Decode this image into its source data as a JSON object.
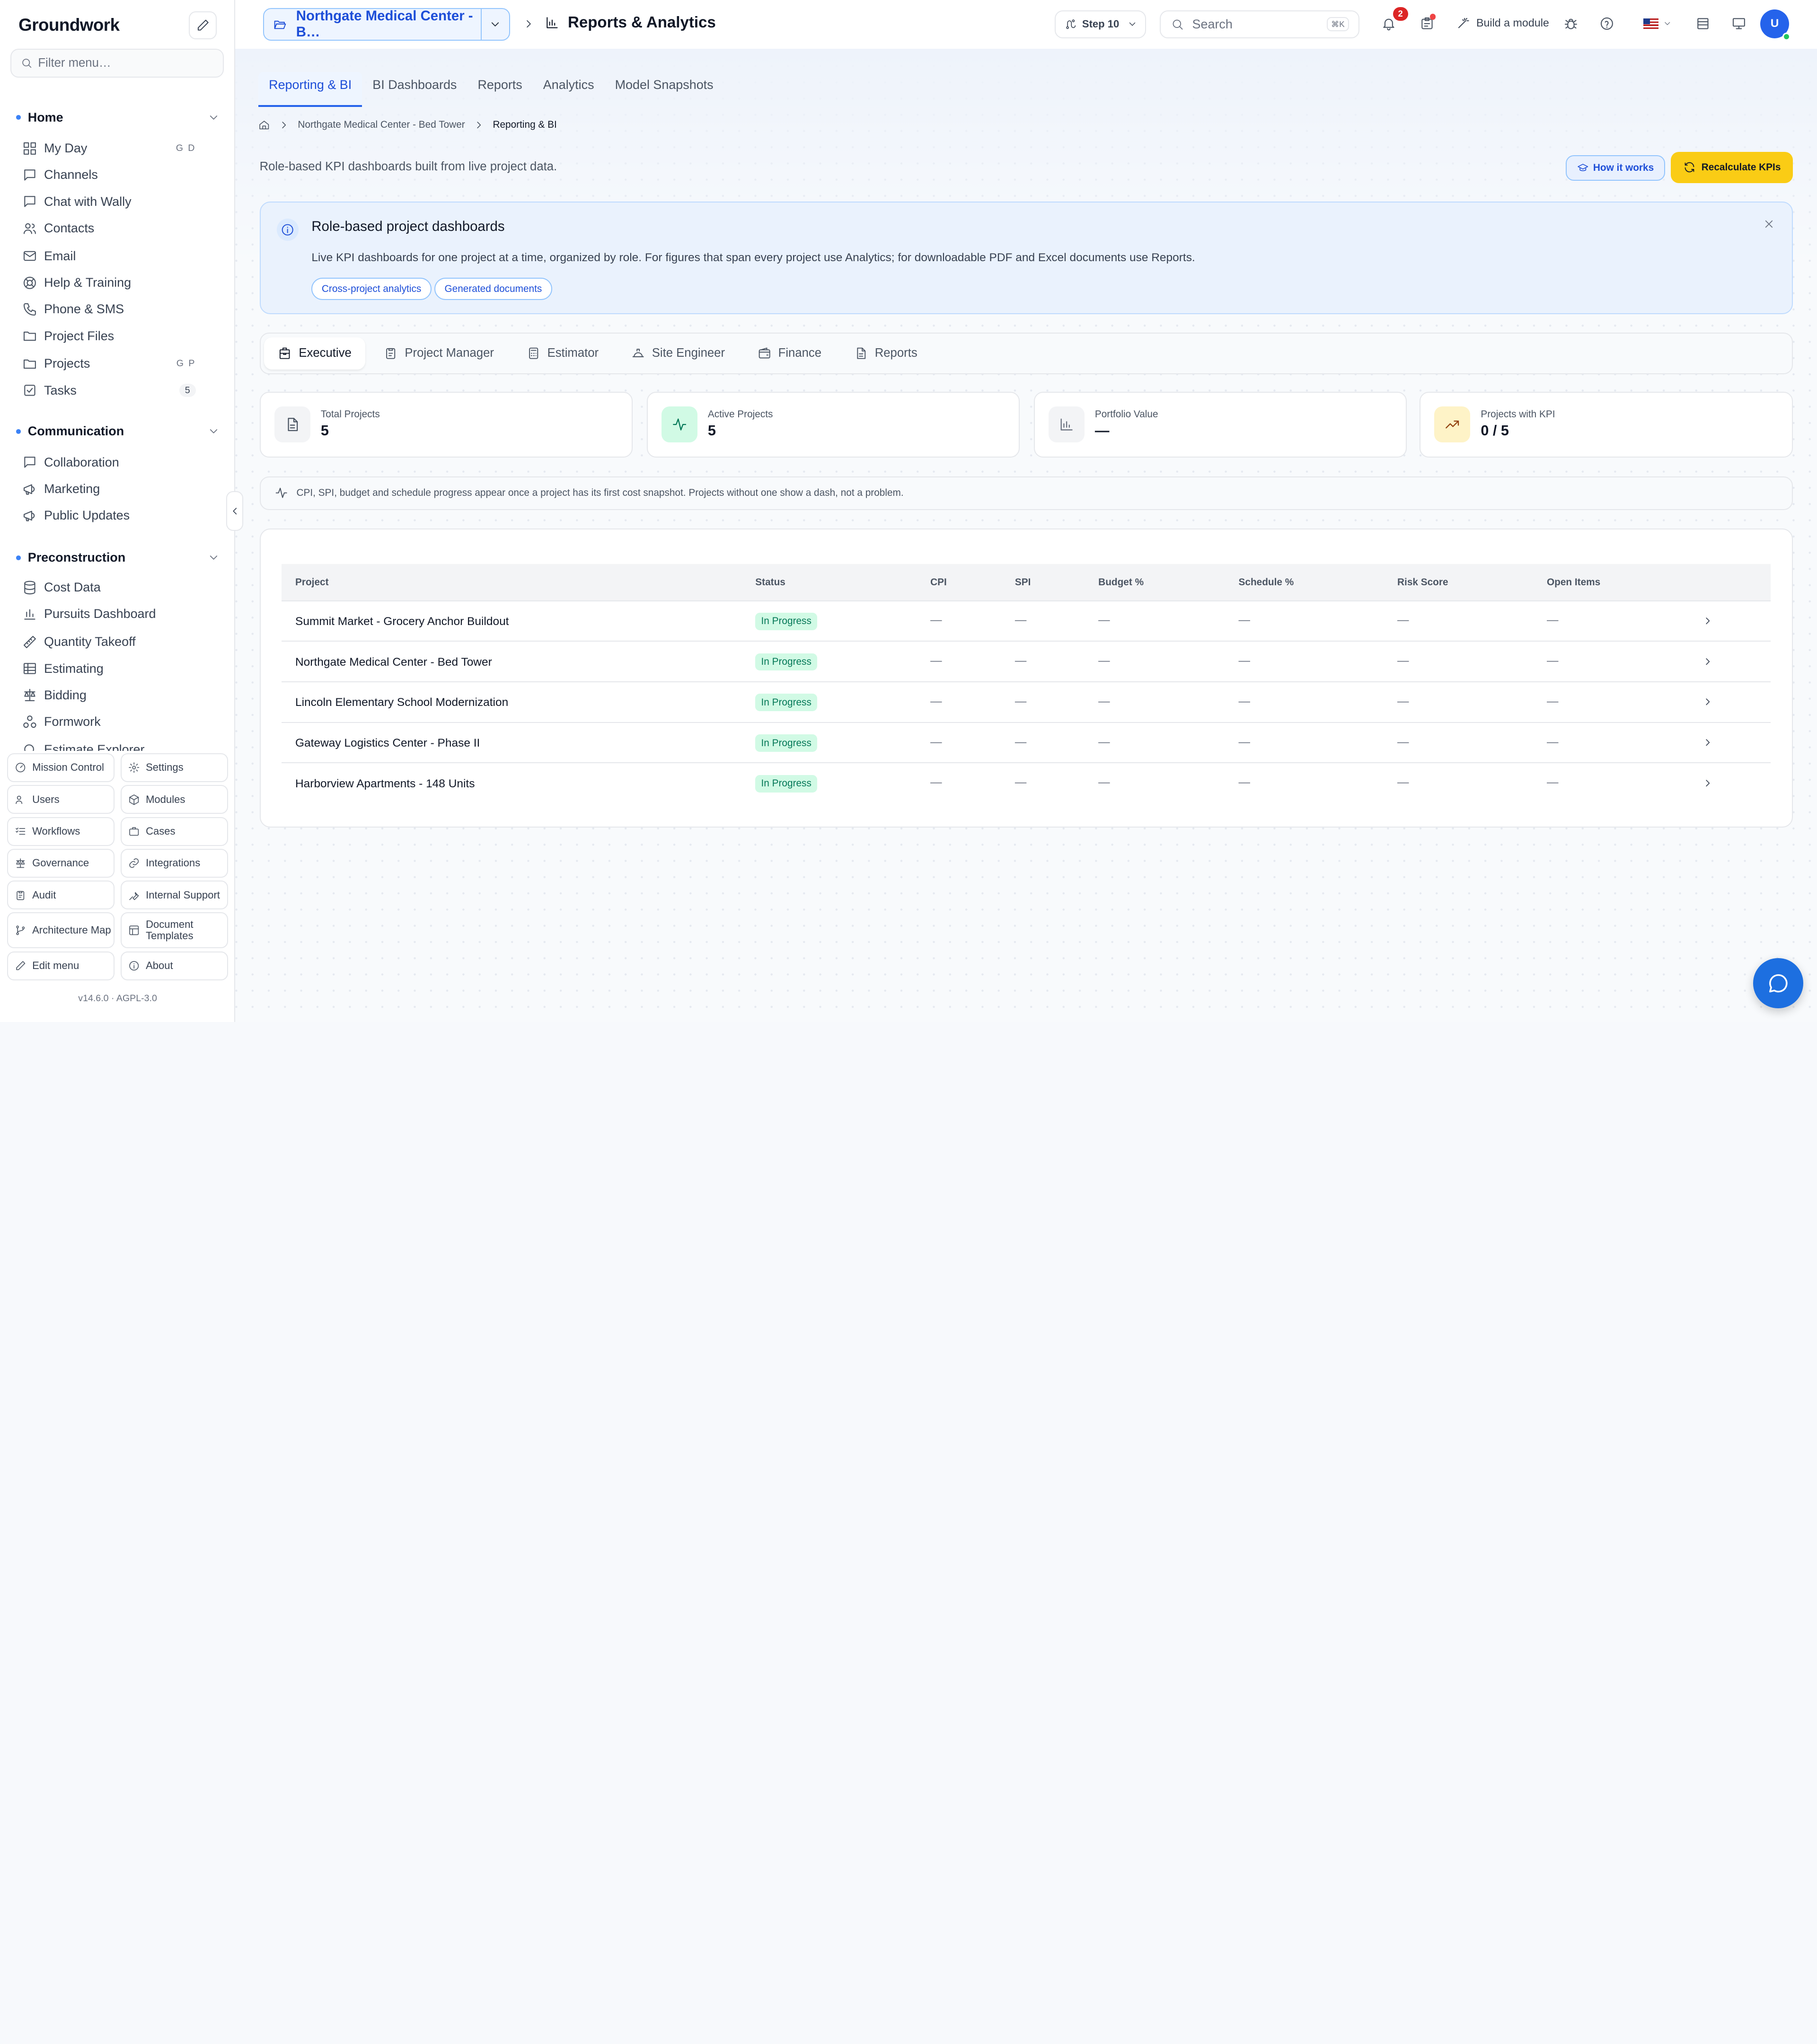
{
  "app": {
    "name": "Groundwork",
    "version": "v14.6.0",
    "license": "AGPL-3.0"
  },
  "sidebar": {
    "filter_placeholder": "Filter menu…",
    "sections": [
      {
        "title": "Home",
        "items": [
          {
            "label": "My Day",
            "icon": "grid-icon",
            "shortcut": "G D"
          },
          {
            "label": "Channels",
            "icon": "chat-icon"
          },
          {
            "label": "Chat with Wally",
            "icon": "chat-icon"
          },
          {
            "label": "Contacts",
            "icon": "users-icon"
          },
          {
            "label": "Email",
            "icon": "mail-icon"
          },
          {
            "label": "Help & Training",
            "icon": "lifebuoy-icon"
          },
          {
            "label": "Phone & SMS",
            "icon": "phone-icon"
          },
          {
            "label": "Project Files",
            "icon": "folder-icon"
          },
          {
            "label": "Projects",
            "icon": "folder-icon",
            "shortcut": "G P"
          },
          {
            "label": "Tasks",
            "icon": "checkbox-icon",
            "badge": "5"
          }
        ]
      },
      {
        "title": "Communication",
        "items": [
          {
            "label": "Collaboration",
            "icon": "chat-icon"
          },
          {
            "label": "Marketing",
            "icon": "megaphone-icon"
          },
          {
            "label": "Public Updates",
            "icon": "megaphone-icon"
          }
        ]
      },
      {
        "title": "Preconstruction",
        "items": [
          {
            "label": "Cost Data",
            "icon": "database-icon"
          },
          {
            "label": "Pursuits Dashboard",
            "icon": "bar-chart-icon"
          },
          {
            "label": "Quantity Takeoff",
            "icon": "ruler-icon"
          },
          {
            "label": "Estimating",
            "icon": "table-icon"
          },
          {
            "label": "Bidding",
            "icon": "scale-icon"
          },
          {
            "label": "Formwork",
            "icon": "blocks-icon"
          },
          {
            "label": "Estimate Explorer",
            "icon": "search-icon"
          }
        ]
      }
    ],
    "tiles": [
      {
        "label": "Mission Control",
        "icon": "gauge-icon"
      },
      {
        "label": "Settings",
        "icon": "gear-icon"
      },
      {
        "label": "Users",
        "icon": "users-icon"
      },
      {
        "label": "Modules",
        "icon": "box-icon"
      },
      {
        "label": "Workflows",
        "icon": "list-check-icon"
      },
      {
        "label": "Cases",
        "icon": "briefcase-icon"
      },
      {
        "label": "Governance",
        "icon": "scale-icon"
      },
      {
        "label": "Integrations",
        "icon": "link-icon"
      },
      {
        "label": "Audit",
        "icon": "clipboard-icon"
      },
      {
        "label": "Internal Support",
        "icon": "wrench-icon"
      },
      {
        "label": "Architecture Map",
        "icon": "git-branch-icon"
      },
      {
        "label": "Document Templates",
        "icon": "template-icon"
      },
      {
        "label": "Edit menu",
        "icon": "pencil-icon"
      },
      {
        "label": "About",
        "icon": "info-icon"
      }
    ]
  },
  "topbar": {
    "project": "Northgate Medical Center - B…",
    "page_title": "Reports & Analytics",
    "step": "Step 10",
    "search_placeholder": "Search",
    "search_kbd": "⌘K",
    "notifications": "2",
    "build_label": "Build a module",
    "avatar": "U"
  },
  "tabs": [
    "Reporting & BI",
    "BI Dashboards",
    "Reports",
    "Analytics",
    "Model Snapshots"
  ],
  "breadcrumb": [
    "Northgate Medical Center - Bed Tower",
    "Reporting & BI"
  ],
  "subtitle": "Role-based KPI dashboards built from live project data.",
  "buttons": {
    "how": "How it works",
    "recalc": "Recalculate KPIs"
  },
  "info": {
    "title": "Role-based project dashboards",
    "body": "Live KPI dashboards for one project at a time, organized by role. For figures that span every project use Analytics; for downloadable PDF and Excel documents use Reports.",
    "chips": [
      "Cross-project analytics",
      "Generated documents"
    ]
  },
  "roles": [
    {
      "label": "Executive",
      "icon": "building-icon"
    },
    {
      "label": "Project Manager",
      "icon": "clipboard-icon"
    },
    {
      "label": "Estimator",
      "icon": "calculator-icon"
    },
    {
      "label": "Site Engineer",
      "icon": "hardhat-icon"
    },
    {
      "label": "Finance",
      "icon": "wallet-icon"
    },
    {
      "label": "Reports",
      "icon": "file-icon"
    }
  ],
  "kpis": [
    {
      "label": "Total Projects",
      "value": "5",
      "icon": "file-icon",
      "color": "#f3f4f6"
    },
    {
      "label": "Active Projects",
      "value": "5",
      "icon": "activity-icon",
      "color": "#d1fae5"
    },
    {
      "label": "Portfolio Value",
      "value": "—",
      "icon": "bar-chart-icon",
      "color": "#f3f4f6"
    },
    {
      "label": "Projects with KPI",
      "value": "0 / 5",
      "icon": "trending-up-icon",
      "color": "#fef3c7"
    }
  ],
  "note": "CPI, SPI, budget and schedule progress appear once a project has its first cost snapshot. Projects without one show a dash, not a problem.",
  "table": {
    "columns": [
      "Project",
      "Status",
      "CPI",
      "SPI",
      "Budget %",
      "Schedule %",
      "Risk Score",
      "Open Items"
    ],
    "rows": [
      {
        "project": "Summit Market - Grocery Anchor Buildout",
        "status": "In Progress",
        "cpi": "—",
        "spi": "—",
        "budget": "—",
        "schedule": "—",
        "risk": "—",
        "open": "—"
      },
      {
        "project": "Northgate Medical Center - Bed Tower",
        "status": "In Progress",
        "cpi": "—",
        "spi": "—",
        "budget": "—",
        "schedule": "—",
        "risk": "—",
        "open": "—"
      },
      {
        "project": "Lincoln Elementary School Modernization",
        "status": "In Progress",
        "cpi": "—",
        "spi": "—",
        "budget": "—",
        "schedule": "—",
        "risk": "—",
        "open": "—"
      },
      {
        "project": "Gateway Logistics Center - Phase II",
        "status": "In Progress",
        "cpi": "—",
        "spi": "—",
        "budget": "—",
        "schedule": "—",
        "risk": "—",
        "open": "—"
      },
      {
        "project": "Harborview Apartments - 148 Units",
        "status": "In Progress",
        "cpi": "—",
        "spi": "—",
        "budget": "—",
        "schedule": "—",
        "risk": "—",
        "open": "—"
      }
    ]
  },
  "colors": {
    "accent": "#2563eb",
    "brand_yellow": "#facc15",
    "status_green": "#047857"
  }
}
